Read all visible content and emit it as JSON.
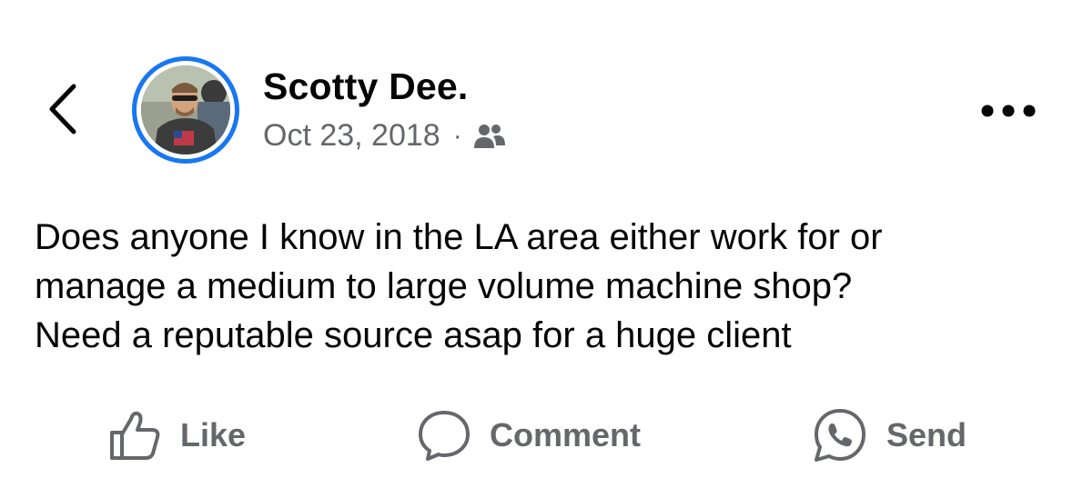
{
  "header": {
    "back_icon": "chevron-left-icon",
    "more_icon": "more-horizontal-icon"
  },
  "post": {
    "author": "Scotty Dee.",
    "date": "Oct 23, 2018",
    "separator": "·",
    "audience_icon": "friends-icon",
    "text": "Does anyone I know in the LA area either work for or\nmanage a medium to large volume machine shop?\nNeed a reputable source asap for a huge client"
  },
  "actions": {
    "like": {
      "label": "Like",
      "icon": "thumbs-up-icon"
    },
    "comment": {
      "label": "Comment",
      "icon": "comment-bubble-icon"
    },
    "send": {
      "label": "Send",
      "icon": "whatsapp-icon"
    }
  },
  "colors": {
    "story_ring": "#1877f2",
    "secondary_text": "#65676b",
    "primary_text": "#050505"
  }
}
